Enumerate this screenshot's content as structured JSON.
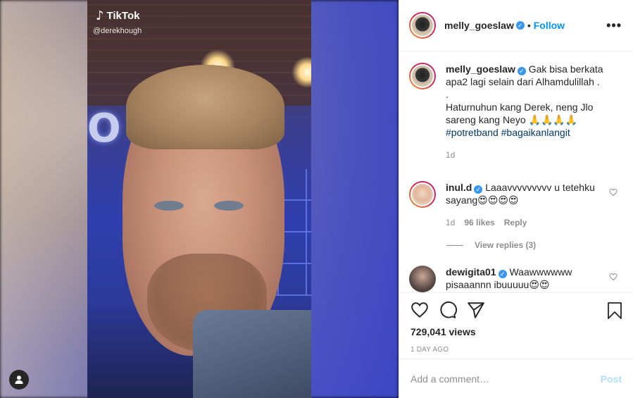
{
  "media": {
    "watermark_brand": "TikTok",
    "watermark_handle": "@derekhough",
    "user_tag_icon": "user-icon"
  },
  "header": {
    "username": "melly_goeslaw",
    "follow_label": "Follow",
    "more_icon": "more-options-icon"
  },
  "caption": {
    "username": "melly_goeslaw",
    "lines": [
      "Gak bisa berkata apa2 lagi selain dari Alhamdulillah .",
      ".",
      "Haturnuhun kang Derek, neng Jlo sareng kang Neyo 🙏🙏🙏🙏"
    ],
    "hashtags": [
      "#potretband",
      "#bagaikanlangit"
    ],
    "time": "1d"
  },
  "comments": [
    {
      "username": "inul.d",
      "text": "Laaavvvvvvvvv u tetehku sayang😍😍😍😍",
      "time": "1d",
      "likes": "96 likes",
      "reply_label": "Reply",
      "view_replies": "View replies (3)"
    },
    {
      "username": "dewigita01",
      "text": "Waawwwwww pisaaannn ibuuuuu😍😍"
    }
  ],
  "actions": {
    "views": "729,041 views",
    "date": "1 DAY AGO"
  },
  "add_comment": {
    "placeholder": "Add a comment…",
    "post_label": "Post"
  },
  "colors": {
    "link_blue": "#0095f6",
    "verified_blue": "#3897f0",
    "muted": "#8e8e8e",
    "post_disabled": "#b2dffc"
  }
}
